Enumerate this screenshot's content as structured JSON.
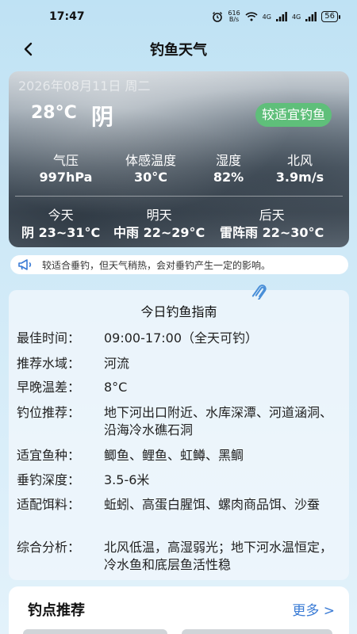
{
  "status_bar": {
    "time": "17:47",
    "net_speed_top": "616",
    "net_speed_bottom": "B/s",
    "signal1": "4G",
    "signal2": "4G",
    "battery": "56"
  },
  "nav": {
    "title": "钓鱼天气"
  },
  "weather": {
    "date": "2026年08月11日 周二",
    "temperature": "28°C",
    "condition": "阴",
    "badge": "较适宜钓鱼",
    "metrics": [
      {
        "label": "气压",
        "value": "997hPa"
      },
      {
        "label": "体感温度",
        "value": "30°C"
      },
      {
        "label": "湿度",
        "value": "82%"
      },
      {
        "label": "北风",
        "value": "3.9m/s"
      }
    ],
    "forecast": [
      {
        "label": "今天",
        "value": "阴 23~31°C"
      },
      {
        "label": "明天",
        "value": "中雨 22~29°C"
      },
      {
        "label": "后天",
        "value": "雷阵雨 22~30°C"
      }
    ]
  },
  "tip": {
    "text": "较适合垂钓，但天气稍热，会对垂钓产生一定的影响。"
  },
  "guide": {
    "title": "今日钓鱼指南",
    "rows": [
      {
        "label": "最佳时间：",
        "value": "09:00-17:00（全天可钓）"
      },
      {
        "label": "推荐水域：",
        "value": "河流"
      },
      {
        "label": "早晚温差：",
        "value": "8°C"
      },
      {
        "label": "钓位推荐：",
        "value": "地下河出口附近、水库深潭、河道涵洞、沿海冷水礁石洞"
      },
      {
        "label": "适宜鱼种：",
        "value": "鲫鱼、鲤鱼、虹鳟、黑鲷"
      },
      {
        "label": "垂钓深度：",
        "value": "3.5-6米"
      },
      {
        "label": "适配饵料：",
        "value": "蚯蚓、高蛋白腥饵、螺肉商品饵、沙蚕"
      },
      {
        "label": "综合分析：",
        "value": "北风低温，高湿弱光；地下河水温恒定，冷水鱼和底层鱼活性稳"
      }
    ]
  },
  "spots": {
    "title": "钓点推荐",
    "more": "更多 >"
  },
  "colors": {
    "accent": "#3a7bd5",
    "badge": "#5fbf7a",
    "bg": "#cfe9f7"
  }
}
